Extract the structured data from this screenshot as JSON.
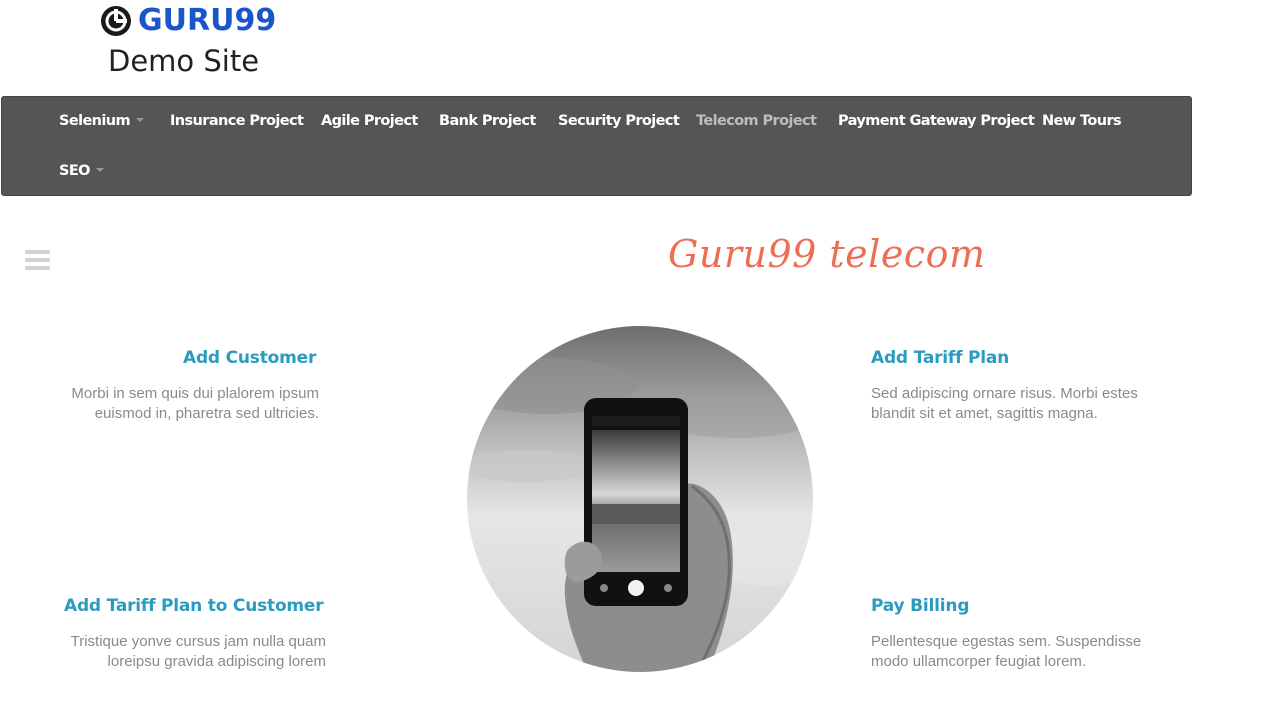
{
  "logo": {
    "brand": "GURU99",
    "subtitle": "Demo Site",
    "icon": "guru99-logo-icon",
    "brand_color": "#1a56c9"
  },
  "nav": {
    "background": "#555555",
    "items": [
      {
        "label": "Selenium",
        "has_dropdown": true
      },
      {
        "label": "Insurance Project"
      },
      {
        "label": "Agile Project"
      },
      {
        "label": "Bank Project"
      },
      {
        "label": "Security Project"
      },
      {
        "label": "Telecom Project",
        "active": true
      },
      {
        "label": "Payment Gateway Project"
      },
      {
        "label": "New Tours"
      },
      {
        "label": "SEO",
        "has_dropdown": true
      }
    ]
  },
  "menu_icon": "hamburger-menu-icon",
  "heading": {
    "text": "Guru99 telecom",
    "color": "#ee6d55"
  },
  "features": {
    "add_customer": {
      "title": "Add Customer",
      "line1": "Morbi in sem quis dui plalorem ipsum",
      "line2": "euismod in, pharetra sed ultricies."
    },
    "add_tariff_plan": {
      "title": "Add Tariff Plan",
      "line1": "Sed adipiscing ornare risus. Morbi estes",
      "line2": "blandit sit et amet, sagittis magna."
    },
    "add_tariff_plan_to_customer": {
      "title": "Add Tariff Plan to Customer",
      "line1": "Tristique yonve cursus jam nulla quam",
      "line2": "loreipsu gravida adipiscing lorem"
    },
    "pay_billing": {
      "title": "Pay Billing",
      "line1": "Pellentesque egestas sem. Suspendisse",
      "line2": "modo ullamcorper feugiat lorem."
    },
    "title_color": "#2b9bbf"
  },
  "center_image": "hand-holding-phone-image"
}
